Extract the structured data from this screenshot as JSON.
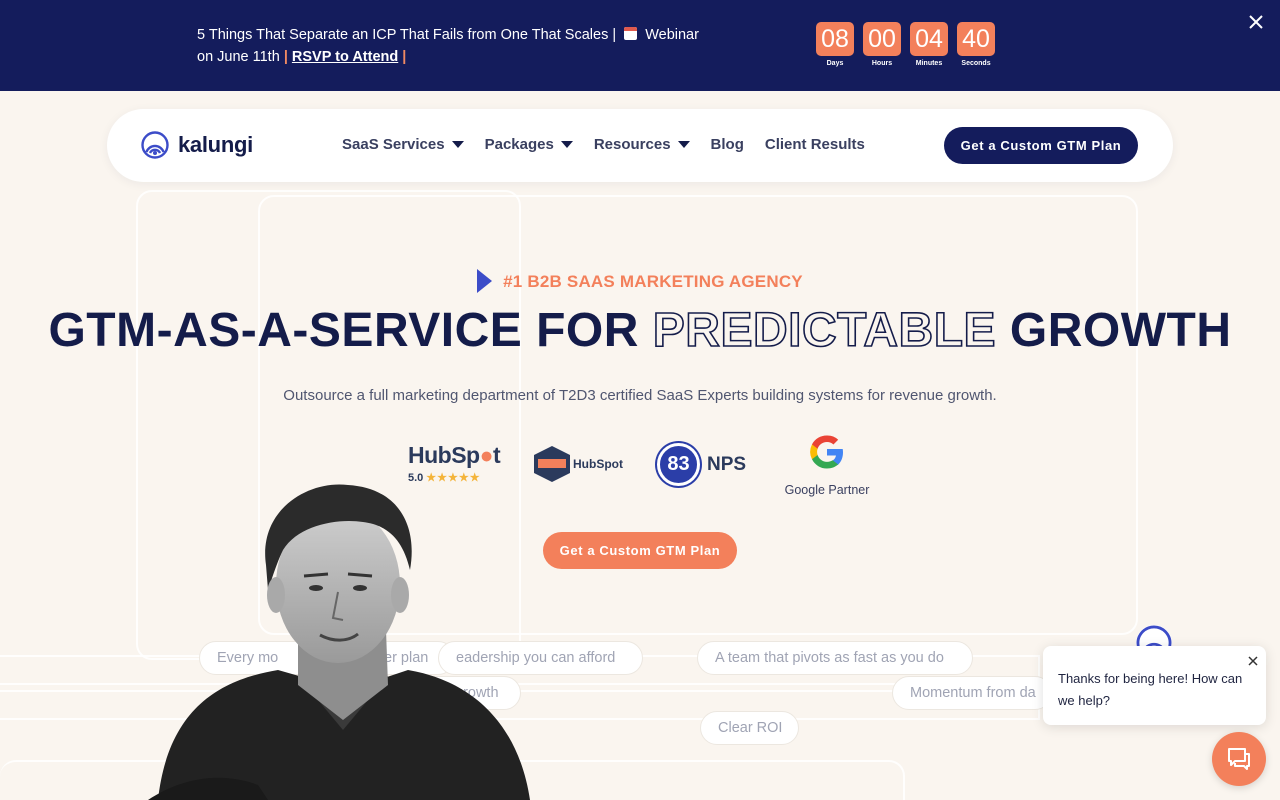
{
  "announcement": {
    "text_before": "5 Things That Separate an ICP That Fails from One That Scales",
    "sep_left": "|",
    "webinar_text": "Webinar on June 11th",
    "sep_mid": "|",
    "rsvp_link": "RSVP to Attend",
    "sep_right": "|",
    "countdown": [
      {
        "value": "08",
        "label": "Days"
      },
      {
        "value": "00",
        "label": "Hours"
      },
      {
        "value": "04",
        "label": "Minutes"
      },
      {
        "value": "40",
        "label": "Seconds"
      }
    ],
    "close_icon": "close-icon"
  },
  "nav": {
    "logo_text": "kalungi",
    "items": [
      {
        "label": "SaaS Services",
        "has_dropdown": true
      },
      {
        "label": "Packages",
        "has_dropdown": true
      },
      {
        "label": "Resources",
        "has_dropdown": true
      },
      {
        "label": "Blog",
        "has_dropdown": false
      },
      {
        "label": "Client Results",
        "has_dropdown": false
      }
    ],
    "cta_label": "Get a Custom GTM Plan"
  },
  "hero": {
    "eyebrow": "#1 B2B SAAS MARKETING AGENCY",
    "headline_part1": "GTM-AS-A-SERVICE FOR",
    "headline_outline": "PREDICTABLE",
    "headline_part2": "GROWTH",
    "subtitle": "Outsource a full marketing department of T2D3 certified SaaS Experts building systems for revenue growth.",
    "cta_label": "Get a Custom GTM Plan"
  },
  "badges": {
    "hubspot_word_a": "HubSp",
    "hubspot_word_b": "t",
    "hubspot_rating": "5.0",
    "hubspot_stars": "★★★★★",
    "diamond_label": "HubSpot",
    "nps_value": "83",
    "nps_label": "NPS",
    "google_label": "Google Partner"
  },
  "pills": [
    "Every mo",
    "er plan",
    "eadership you can afford",
    "A team that pivots as fast as you do",
    "growth",
    "Momentum from da",
    "Clear ROI"
  ],
  "chat": {
    "message": "Thanks for being here! How can we help?"
  },
  "colors": {
    "navy": "#141c5c",
    "coral": "#f3805b",
    "cream": "#faf5ef",
    "royal_blue": "#3c4cc8"
  }
}
